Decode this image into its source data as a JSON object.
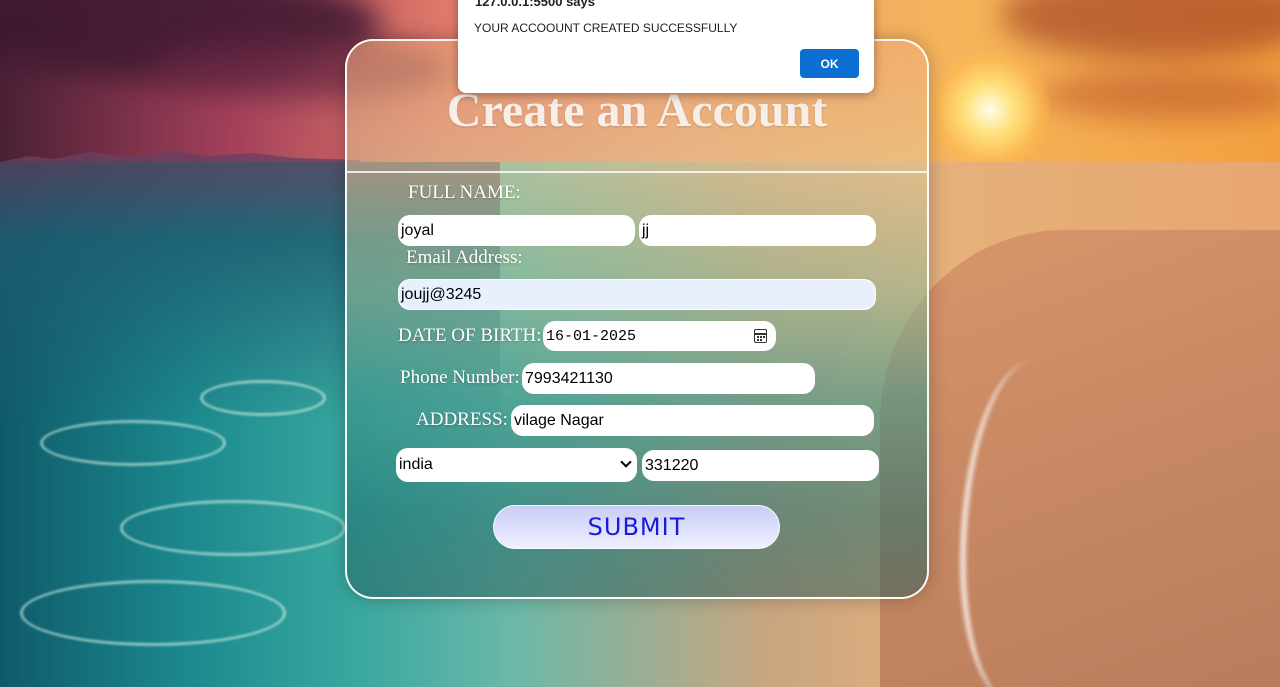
{
  "dialog": {
    "title": "127.0.0.1:5500 says",
    "message": "YOUR ACCOOUNT CREATED SUCCESSFULLY",
    "ok_label": "OK"
  },
  "form": {
    "title": "Create an Account",
    "full_name_label": "FULL NAME:",
    "first_name_value": "joyal",
    "last_name_value": "jj",
    "email_label": "Email Address:",
    "email_value": "joujj@3245",
    "dob_label": "DATE OF BIRTH:",
    "dob_value": "16-01-2025",
    "phone_label": "Phone Number:",
    "phone_value": "7993421130",
    "address_label": "ADDRESS:",
    "address_value": "vilage Nagar",
    "country_value": "india",
    "pincode_value": "331220",
    "submit_label": "SUBMIT"
  },
  "colors": {
    "submit_text": "#1a1ad8",
    "dialog_button": "#0b6fd1",
    "autofill_bg": "#e8f0fe"
  },
  "icons": {
    "date_picker": "calendar-icon",
    "select": "chevron-down-icon"
  }
}
